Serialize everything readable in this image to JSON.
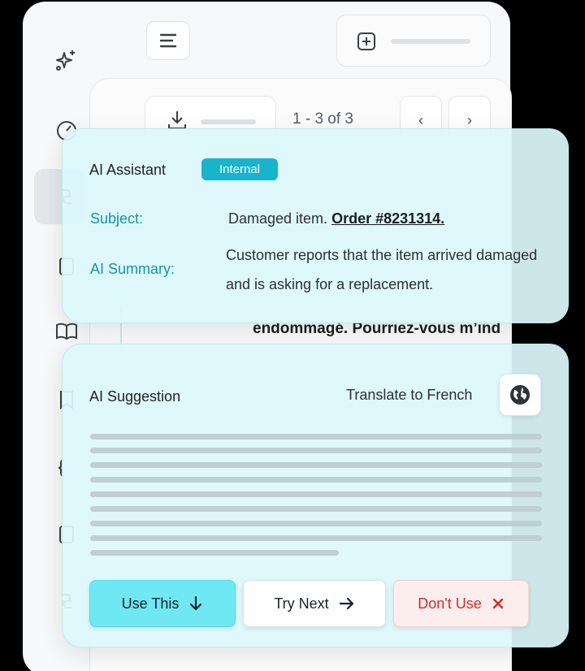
{
  "pagination": {
    "range_text": "1 - 3 of 3",
    "prev_icon": "chevron-left-icon",
    "next_icon": "chevron-right-icon"
  },
  "background": {
    "visible_snippet": "endommagé. Pourriez-vous m’ind"
  },
  "assistant": {
    "title": "AI Assistant",
    "badge": "Internal",
    "subject_label": "Subject:",
    "subject_text": "Damaged item.",
    "order_link": "Order #8231314.",
    "summary_label": "AI Summary:",
    "summary_text": "Customer reports that the item arrived damaged and is asking for a replacement.",
    "accent": "#1494ab",
    "badge_color": "#17b4cc"
  },
  "suggestion": {
    "title": "AI Suggestion",
    "translate_label": "Translate to French",
    "globe_icon": "globe-icon",
    "use_label": "Use This",
    "next_label": "Try Next",
    "dont_label": "Don't Use",
    "use_color": "#6fe8f4",
    "dont_color": "#d72a2a"
  }
}
